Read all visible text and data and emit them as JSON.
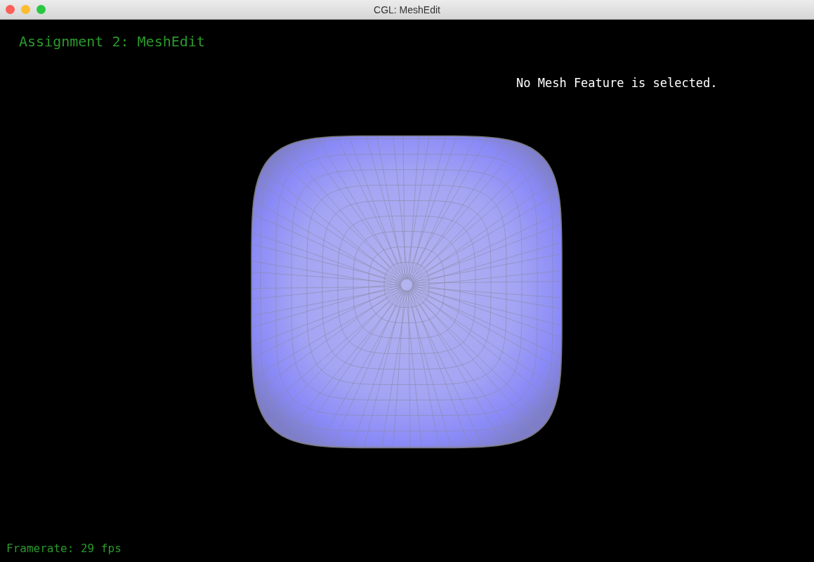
{
  "window": {
    "title": "CGL: MeshEdit"
  },
  "overlay": {
    "heading": "Assignment 2: MeshEdit",
    "selection_info": "No Mesh Feature is selected.",
    "framerate": "Framerate: 29 fps"
  }
}
